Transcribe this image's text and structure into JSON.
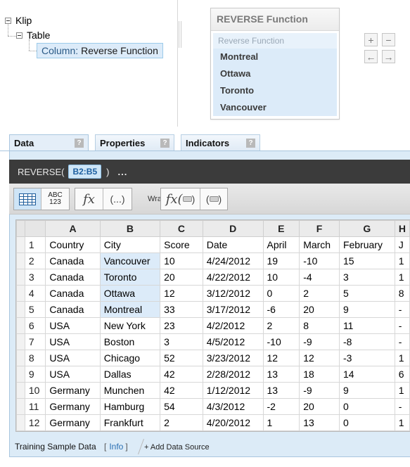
{
  "tree": {
    "root": "Klip",
    "child": "Table",
    "selected_prefix": "Column:",
    "selected_label": "Reverse Function"
  },
  "preview": {
    "title": "REVERSE Function",
    "header": "Reverse Function",
    "items": [
      "Montreal",
      "Ottawa",
      "Toronto",
      "Vancouver"
    ]
  },
  "controls": {
    "add": "+",
    "remove": "−",
    "left": "←",
    "right": "→"
  },
  "tabs": [
    {
      "label": "Data",
      "help": "?"
    },
    {
      "label": "Properties",
      "help": "?"
    },
    {
      "label": "Indicators",
      "help": "?"
    }
  ],
  "formula": {
    "function": "REVERSE(",
    "argument": "B2:B5",
    "close": ")",
    "more": "..."
  },
  "toolbar": {
    "abc_top": "ABC",
    "abc_bottom": "123",
    "fx": "fx",
    "parens": "(...)",
    "wrap_label": "Wrap",
    "wrap_fx": "fx(",
    "wrap_fx_close": ")",
    "wrap_paren_open": "(",
    "wrap_paren_close": ")"
  },
  "grid": {
    "columns": [
      "A",
      "B",
      "C",
      "D",
      "E",
      "F",
      "G",
      "H"
    ],
    "rows": [
      [
        "1",
        "Country",
        "City",
        "Score",
        "Date",
        "April",
        "March",
        "February",
        "J"
      ],
      [
        "2",
        "Canada",
        "Vancouver",
        "10",
        "4/24/2012",
        "19",
        "-10",
        "15",
        "1"
      ],
      [
        "3",
        "Canada",
        "Toronto",
        "20",
        "4/22/2012",
        "10",
        "-4",
        "3",
        "1"
      ],
      [
        "4",
        "Canada",
        "Ottawa",
        "12",
        "3/12/2012",
        "0",
        "2",
        "5",
        "8"
      ],
      [
        "5",
        "Canada",
        "Montreal",
        "33",
        "3/17/2012",
        "-6",
        "20",
        "9",
        "-"
      ],
      [
        "6",
        "USA",
        "New York",
        "23",
        "4/2/2012",
        "2",
        "8",
        "11",
        "-"
      ],
      [
        "7",
        "USA",
        "Boston",
        "3",
        "4/5/2012",
        "-10",
        "-9",
        "-8",
        "-"
      ],
      [
        "8",
        "USA",
        "Chicago",
        "52",
        "3/23/2012",
        "12",
        "12",
        "-3",
        "1"
      ],
      [
        "9",
        "USA",
        "Dallas",
        "42",
        "2/28/2012",
        "13",
        "18",
        "14",
        "6"
      ],
      [
        "10",
        "Germany",
        "Munchen",
        "42",
        "1/12/2012",
        "13",
        "-9",
        "9",
        "1"
      ],
      [
        "11",
        "Germany",
        "Hamburg",
        "54",
        "4/3/2012",
        "-2",
        "20",
        "0",
        "-"
      ],
      [
        "12",
        "Germany",
        "Frankfurt",
        "2",
        "4/20/2012",
        "1",
        "13",
        "0",
        "1"
      ]
    ]
  },
  "footer": {
    "source_name": "Training Sample Data",
    "bracket_open": "[",
    "info": "Info",
    "bracket_close": "]",
    "add_source": "+ Add Data Source"
  }
}
